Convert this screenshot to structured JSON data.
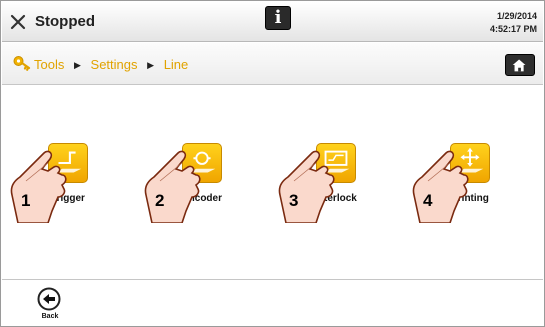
{
  "status": {
    "text": "Stopped",
    "icon": "close-x-icon"
  },
  "info_button": {
    "label": "i",
    "icon": "info-icon"
  },
  "datetime": {
    "date": "1/29/2014",
    "time": "4:52:17 PM"
  },
  "breadcrumb": {
    "icon": "key-icon",
    "items": [
      "Tools",
      "Settings",
      "Line"
    ],
    "separator": "▶"
  },
  "home_button": {
    "icon": "home-icon"
  },
  "tiles": [
    {
      "number": "1",
      "label": "Trigger",
      "icon": "trigger-icon"
    },
    {
      "number": "2",
      "label": "Encoder",
      "icon": "encoder-icon"
    },
    {
      "number": "3",
      "label": "Interlock",
      "icon": "interlock-icon"
    },
    {
      "number": "4",
      "label": "Printing",
      "icon": "printing-icon"
    }
  ],
  "back_button": {
    "label": "Back",
    "icon": "back-arrow-icon"
  },
  "colors": {
    "accent": "#f2b200",
    "breadcrumb_text": "#e1a300",
    "dark_button": "#2e2e2e",
    "hand_fill": "#fad9cc",
    "hand_stroke": "#7a2a10"
  }
}
